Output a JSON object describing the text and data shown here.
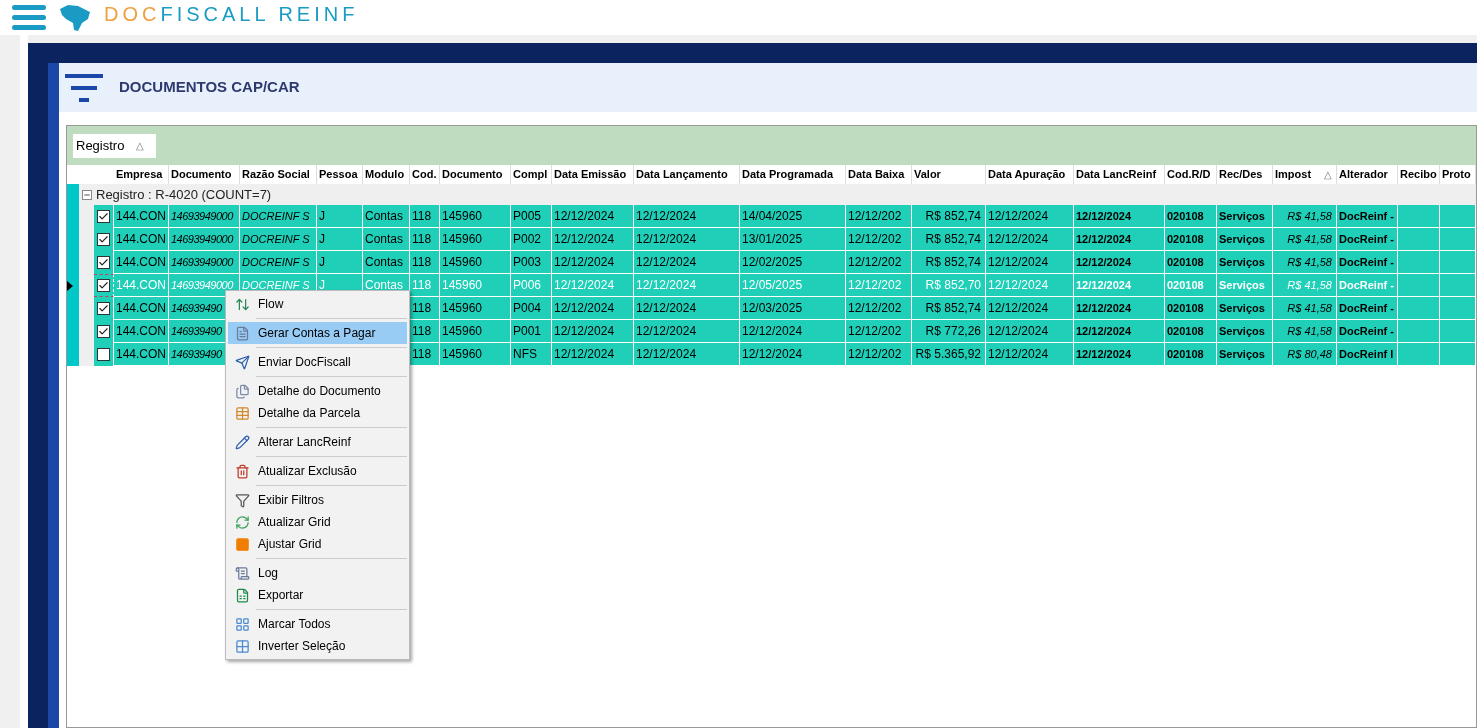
{
  "header": {
    "logo_parts": [
      "DOC",
      "FISCALL",
      "REINF"
    ]
  },
  "panel": {
    "title": "DOCUMENTOS CAP/CAR"
  },
  "grid": {
    "group_chip": {
      "label": "Registro",
      "sort_mark": "△"
    },
    "columns": [
      {
        "label": "Empresa"
      },
      {
        "label": "Documento"
      },
      {
        "label": "Razão Social"
      },
      {
        "label": "Pessoa"
      },
      {
        "label": "Modulo"
      },
      {
        "label": "Cod."
      },
      {
        "label": "Documento"
      },
      {
        "label": "Compl"
      },
      {
        "label": "Data Emissão"
      },
      {
        "label": "Data Lançamento"
      },
      {
        "label": "Data Programada"
      },
      {
        "label": "Data Baixa"
      },
      {
        "label": "Valor"
      },
      {
        "label": "Data Apuração"
      },
      {
        "label": "Data LancReinf"
      },
      {
        "label": "Cod.R/D"
      },
      {
        "label": "Rec/Des"
      },
      {
        "label": "Impost",
        "sort_mark": "△"
      },
      {
        "label": "Alterador"
      },
      {
        "label": "Recibo"
      },
      {
        "label": "Proto"
      }
    ],
    "group": {
      "label": "Registro : R-4020 (COUNT=7)",
      "expanded": true
    },
    "rows": [
      {
        "checked": true,
        "selected": false,
        "cells": [
          "144.CON",
          "14693949000",
          "DOCREINF S",
          "J",
          "Contas",
          "118",
          "145960",
          "P005",
          "12/12/2024",
          "12/12/2024",
          "14/04/2025",
          "12/12/202",
          "R$ 852,74",
          "12/12/2024",
          "12/12/2024",
          "020108",
          "Serviços",
          "R$ 41,58",
          "DocReinf -"
        ]
      },
      {
        "checked": true,
        "selected": false,
        "cells": [
          "144.CON",
          "14693949000",
          "DOCREINF S",
          "J",
          "Contas",
          "118",
          "145960",
          "P002",
          "12/12/2024",
          "12/12/2024",
          "13/01/2025",
          "12/12/202",
          "R$ 852,74",
          "12/12/2024",
          "12/12/2024",
          "020108",
          "Serviços",
          "R$ 41,58",
          "DocReinf -"
        ]
      },
      {
        "checked": true,
        "selected": false,
        "cells": [
          "144.CON",
          "14693949000",
          "DOCREINF S",
          "J",
          "Contas",
          "118",
          "145960",
          "P003",
          "12/12/2024",
          "12/12/2024",
          "12/02/2025",
          "12/12/202",
          "R$ 852,74",
          "12/12/2024",
          "12/12/2024",
          "020108",
          "Serviços",
          "R$ 41,58",
          "DocReinf -"
        ]
      },
      {
        "checked": true,
        "selected": true,
        "cells": [
          "144.CON",
          "14693949000",
          "DOCREINF S",
          "J",
          "Contas",
          "118",
          "145960",
          "P006",
          "12/12/2024",
          "12/12/2024",
          "12/05/2025",
          "12/12/202",
          "R$ 852,70",
          "12/12/2024",
          "12/12/2024",
          "020108",
          "Serviços",
          "R$ 41,58",
          "DocReinf -"
        ]
      },
      {
        "checked": true,
        "selected": false,
        "cells": [
          "144.CON",
          "146939490",
          null,
          null,
          null,
          "118",
          "145960",
          "P004",
          "12/12/2024",
          "12/12/2024",
          "12/03/2025",
          "12/12/202",
          "R$ 852,74",
          "12/12/2024",
          "12/12/2024",
          "020108",
          "Serviços",
          "R$ 41,58",
          "DocReinf -"
        ]
      },
      {
        "checked": true,
        "selected": false,
        "cells": [
          "144.CON",
          "146939490",
          null,
          null,
          null,
          "118",
          "145960",
          "P001",
          "12/12/2024",
          "12/12/2024",
          "12/12/2024",
          "12/12/202",
          "R$ 772,26",
          "12/12/2024",
          "12/12/2024",
          "020108",
          "Serviços",
          "R$ 41,58",
          "DocReinf -"
        ]
      },
      {
        "checked": false,
        "selected": false,
        "cells": [
          "144.CON",
          "146939490",
          null,
          null,
          null,
          "118",
          "145960",
          "NFS",
          "12/12/2024",
          "12/12/2024",
          "12/12/2024",
          "12/12/202",
          "R$ 5.365,92",
          "12/12/2024",
          "12/12/2024",
          "020108",
          "Serviços",
          "R$ 80,48",
          "DocReinf I"
        ]
      }
    ]
  },
  "context_menu": {
    "groups": [
      [
        {
          "label": "Flow",
          "selected": false
        }
      ],
      [
        {
          "label": "Gerar Contas a Pagar",
          "selected": true
        }
      ],
      [
        {
          "label": "Enviar DocFiscall",
          "selected": false
        }
      ],
      [
        {
          "label": "Detalhe do Documento",
          "selected": false
        },
        {
          "label": "Detalhe da Parcela",
          "selected": false
        }
      ],
      [
        {
          "label": "Alterar LancReinf",
          "selected": false
        }
      ],
      [
        {
          "label": "Atualizar Exclusão",
          "selected": false
        }
      ],
      [
        {
          "label": "Exibir Filtros",
          "selected": false
        },
        {
          "label": "Atualizar Grid",
          "selected": false
        },
        {
          "label": "Ajustar Grid",
          "selected": false
        }
      ],
      [
        {
          "label": "Log",
          "selected": false
        },
        {
          "label": "Exportar",
          "selected": false
        }
      ],
      [
        {
          "label": "Marcar Todos",
          "selected": false
        },
        {
          "label": "Inverter Seleção",
          "selected": false
        }
      ]
    ]
  }
}
